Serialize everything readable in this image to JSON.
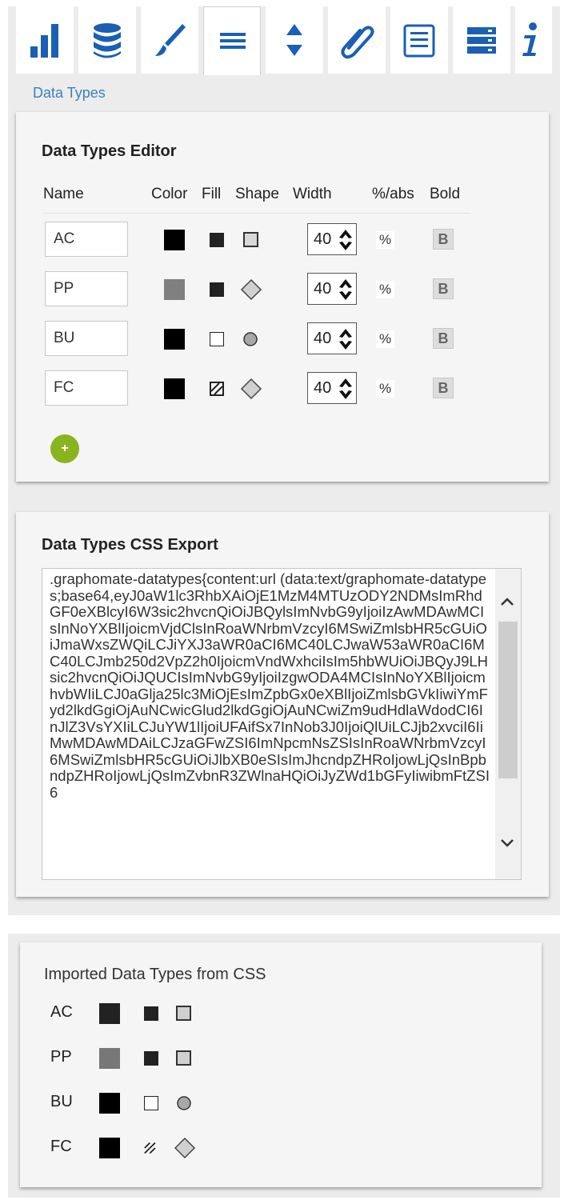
{
  "toolbar": {
    "tabs": [
      {
        "icon": "bar-chart-icon"
      },
      {
        "icon": "database-icon"
      },
      {
        "icon": "brush-icon"
      },
      {
        "icon": "menu-icon",
        "active": true
      },
      {
        "icon": "sort-arrows-icon"
      },
      {
        "icon": "paperclip-icon"
      },
      {
        "icon": "numbered-list-icon"
      },
      {
        "icon": "server-stack-icon"
      },
      {
        "icon": "info-icon"
      }
    ],
    "accent": "#1a5fb4"
  },
  "section_label": "Data Types",
  "editor": {
    "title": "Data Types Editor",
    "columns": {
      "name": "Name",
      "color": "Color",
      "fill": "Fill",
      "shape": "Shape",
      "width": "Width",
      "pct_abs": "%/abs",
      "bold": "Bold"
    },
    "rows": [
      {
        "name": "AC",
        "color": "#000000",
        "fill": "solid",
        "shape": "square",
        "width": "40",
        "unit": "%",
        "bold_label": "B"
      },
      {
        "name": "PP",
        "color": "#808080",
        "fill": "solid",
        "shape": "diamond",
        "width": "40",
        "unit": "%",
        "bold_label": "B"
      },
      {
        "name": "BU",
        "color": "#000000",
        "fill": "outline",
        "shape": "circle",
        "width": "40",
        "unit": "%",
        "bold_label": "B"
      },
      {
        "name": "FC",
        "color": "#000000",
        "fill": "hatched",
        "shape": "diamond",
        "width": "40",
        "unit": "%",
        "bold_label": "B"
      }
    ],
    "add_label": "+",
    "add_color": "#8ab41e"
  },
  "export": {
    "title": "Data Types CSS Export",
    "css_text": ".graphomate-datatypes{content:url (data:text/graphomate-datatypes;base64,eyJ0aW1lc3RhbXAiOjE1MzM4MTUzODY2NDMsImRhdGF0eXBlcyI6W3sic2hvcnQiOiJBQylsImNvbG9yIjoiIzAwMDAwMCIsInNoYXBlIjoicmVjdClsInRoaWNrbmVzcyI6MSwiZmlsbHR5cGUiOiJmaWxsZWQiLCJiYXJ3aWR0aCI6MC40LCJwaW53aWR0aCI6MC40LCJmb250d2VpZ2h0IjoicmVndWxhciIsIm5hbWUiOiJBQyJ9LHsic2hvcnQiOiJQUCIsImNvbG9yIjoiIzgwODA4MCIsInNoYXBlIjoicmhvbWIiLCJ0aGlja25lc3MiOjEsImZpbGx0eXBlIjoiZmlsbGVkIiwiYmFyd2lkdGgiOjAuNCwicGlud2lkdGgiOjAuNCwiZm9udHdlaWdodCI6InJlZ3VsYXIiLCJuYW1lIjoiUFAifSx7InNob3J0IjoiQlUiLCJjb2xvciI6IiMwMDAwMDAiLCJzaGFwZSI6ImNpcmNsZSIsInRoaWNrbmVzcyI6MSwiZmlsbHR5cGUiOiJlbXB0eSIsImJhcndpZHRoIjowLjQsInBpbndpZHRoIjowLjQsImZvbnR3ZWlnaHQiOiJyZWd1bGFyIiwibmFtZSI6"
  },
  "imported": {
    "title": "Imported Data Types from CSS",
    "rows": [
      {
        "name": "AC",
        "color": "#222222",
        "fill": "solid",
        "shape": "square"
      },
      {
        "name": "PP",
        "color": "#777777",
        "fill": "solid",
        "shape": "square"
      },
      {
        "name": "BU",
        "color": "#000000",
        "fill": "outline",
        "shape": "circle"
      },
      {
        "name": "FC",
        "color": "#000000",
        "fill": "hatched",
        "shape": "diamond"
      }
    ]
  }
}
